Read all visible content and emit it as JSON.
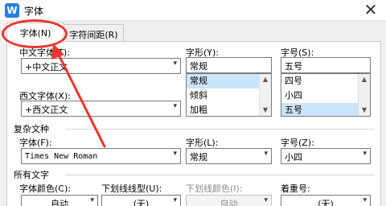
{
  "window": {
    "icon_letter": "W",
    "title": "字体",
    "close_glyph": "✕"
  },
  "tabs": [
    {
      "label": "字体(N)",
      "active": true
    },
    {
      "label": "字符间距(R)",
      "active": false
    }
  ],
  "chinese_font": {
    "label": "中文字体(T):",
    "value": "+中文正文"
  },
  "western_font": {
    "label": "西文字体(X):",
    "value": "+西文正文"
  },
  "style": {
    "label": "字形(Y):",
    "value": "常规",
    "options": [
      "常规",
      "倾斜",
      "加粗"
    ],
    "selected": "常规"
  },
  "size": {
    "label": "字号(S):",
    "value": "五号",
    "options": [
      "四号",
      "小四",
      "五号"
    ],
    "selected": "五号"
  },
  "complex_script": {
    "section_title": "复杂文种",
    "font_label": "字体(F):",
    "font_value": "Times New Roman",
    "style_label": "字形(L):",
    "style_value": "常规",
    "size_label": "字号(Z):",
    "size_value": "小四"
  },
  "all_text": {
    "section_title": "所有文字",
    "font_color_label": "字体颜色(C):",
    "font_color_value": "自动",
    "underline_type_label": "下划线线型(U):",
    "underline_type_value": "(无)",
    "underline_color_label": "下划线颜色(I):",
    "underline_color_value": "自动",
    "emphasis_label": "着重号:",
    "emphasis_value": "(无)"
  },
  "icons": {
    "dropdown": "▾",
    "scroll_up": "▲",
    "scroll_down": "▼"
  },
  "colors": {
    "annotation": "#e8372d",
    "selection": "#cce4f7",
    "app_icon": "#2b7de9"
  }
}
